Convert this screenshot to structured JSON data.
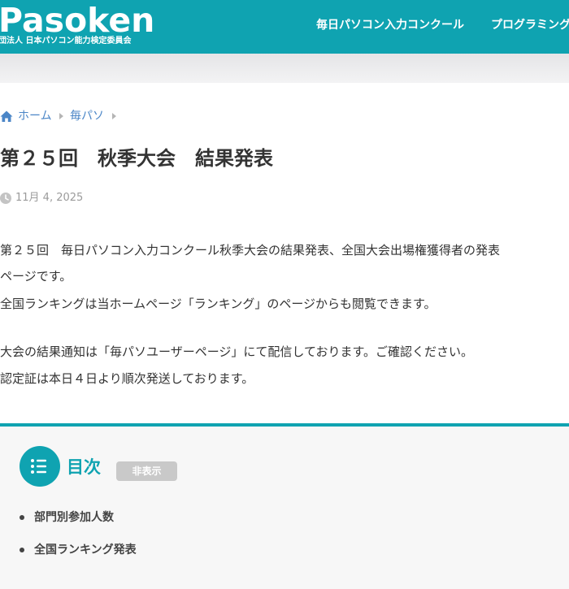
{
  "header": {
    "logo": "Pasoken",
    "org_name": "団法人 日本パソコン能力検定委員会",
    "nav": [
      "毎日パソコン入力コンクール",
      "プログラミング"
    ],
    "brand_color": "#0fa3b1"
  },
  "breadcrumb": {
    "home_icon": "home-icon",
    "home": "ホーム",
    "category": "毎パソ"
  },
  "article": {
    "title": "第２５回　秋季大会　結果発表",
    "date": "11月 4, 2025",
    "paragraphs": [
      "第２５回　毎日パソコン入力コンクール秋季大会の結果発表、全国大会出場権獲得者の発表",
      "ページです。",
      "全国ランキングは当ホームページ「ランキング」のページからも閲覧できます。",
      "大会の結果通知は「毎パソユーザーページ」にて配信しております。ご確認ください。",
      "認定証は本日４日より順次発送しております。"
    ]
  },
  "toc": {
    "icon": "list-icon",
    "title": "目次",
    "toggle_label": "非表示",
    "items": [
      "部門別参加人数",
      "全国ランキング発表"
    ]
  }
}
